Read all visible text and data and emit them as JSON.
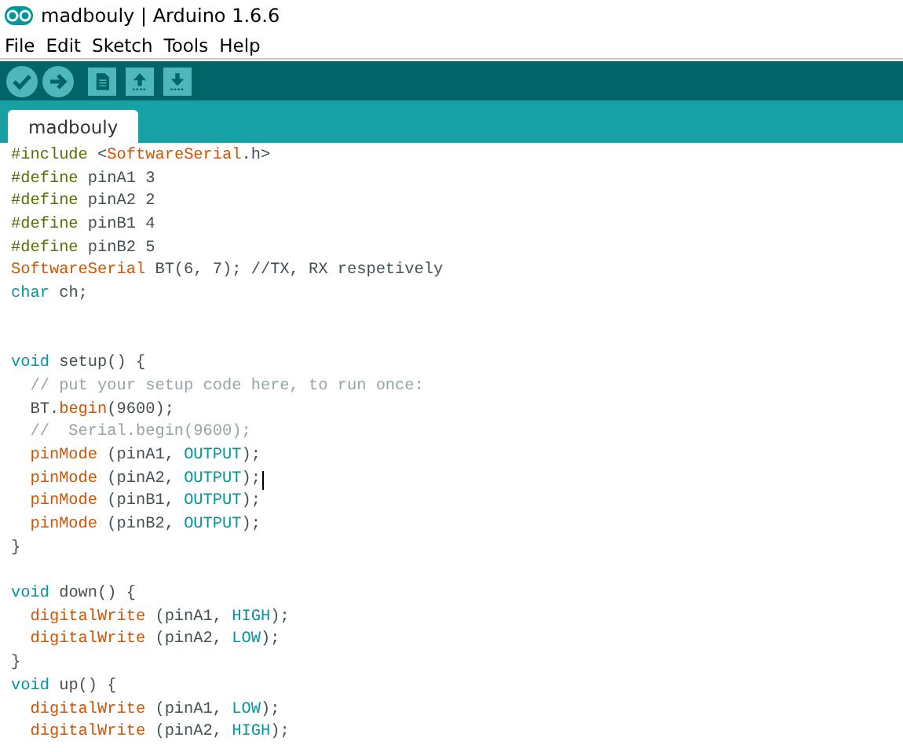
{
  "window": {
    "title": "madbouly | Arduino 1.6.6"
  },
  "menu": [
    "File",
    "Edit",
    "Sketch",
    "Tools",
    "Help"
  ],
  "toolbar": [
    {
      "kind": "verify"
    },
    {
      "kind": "upload"
    },
    {
      "kind": "new"
    },
    {
      "kind": "open"
    },
    {
      "kind": "save"
    }
  ],
  "tabs": [
    {
      "label": "madbouly",
      "selected": true
    }
  ],
  "editor": {
    "lines": [
      {
        "kind": "code",
        "caret": false,
        "tokens": [
          {
            "kind": "directive",
            "text": "#include "
          },
          {
            "kind": "plain",
            "text": "<"
          },
          {
            "kind": "function",
            "text": "SoftwareSerial"
          },
          {
            "kind": "plain",
            "text": ".h>"
          }
        ]
      },
      {
        "kind": "code",
        "caret": false,
        "tokens": [
          {
            "kind": "directive",
            "text": "#define "
          },
          {
            "kind": "plain",
            "text": "pinA1 3"
          }
        ]
      },
      {
        "kind": "code",
        "caret": false,
        "tokens": [
          {
            "kind": "directive",
            "text": "#define "
          },
          {
            "kind": "plain",
            "text": "pinA2 2"
          }
        ]
      },
      {
        "kind": "code",
        "caret": false,
        "tokens": [
          {
            "kind": "directive",
            "text": "#define "
          },
          {
            "kind": "plain",
            "text": "pinB1 4"
          }
        ]
      },
      {
        "kind": "code",
        "caret": false,
        "tokens": [
          {
            "kind": "directive",
            "text": "#define "
          },
          {
            "kind": "plain",
            "text": "pinB2 5"
          }
        ]
      },
      {
        "kind": "code",
        "caret": false,
        "tokens": [
          {
            "kind": "function",
            "text": "SoftwareSerial"
          },
          {
            "kind": "plain",
            "text": " BT(6, 7); //TX, RX respetively"
          }
        ]
      },
      {
        "kind": "code",
        "caret": false,
        "tokens": [
          {
            "kind": "keyword",
            "text": "char"
          },
          {
            "kind": "plain",
            "text": " ch;"
          }
        ]
      },
      {
        "kind": "blank"
      },
      {
        "kind": "blank"
      },
      {
        "kind": "code",
        "caret": false,
        "tokens": [
          {
            "kind": "keyword",
            "text": "void"
          },
          {
            "kind": "plain",
            "text": " setup() {"
          }
        ]
      },
      {
        "kind": "code",
        "caret": false,
        "tokens": [
          {
            "kind": "comment",
            "text": "  // put your setup code here, to run once:"
          }
        ]
      },
      {
        "kind": "code",
        "caret": false,
        "tokens": [
          {
            "kind": "plain",
            "text": "  BT."
          },
          {
            "kind": "function",
            "text": "begin"
          },
          {
            "kind": "plain",
            "text": "(9600);"
          }
        ]
      },
      {
        "kind": "code",
        "caret": false,
        "tokens": [
          {
            "kind": "comment",
            "text": "  //  Serial.begin(9600);"
          }
        ]
      },
      {
        "kind": "code",
        "caret": false,
        "tokens": [
          {
            "kind": "function",
            "text": "  pinMode"
          },
          {
            "kind": "plain",
            "text": " (pinA1, "
          },
          {
            "kind": "constant",
            "text": "OUTPUT"
          },
          {
            "kind": "plain",
            "text": ");"
          }
        ]
      },
      {
        "kind": "code",
        "caret": true,
        "tokens": [
          {
            "kind": "function",
            "text": "  pinMode"
          },
          {
            "kind": "plain",
            "text": " (pinA2, "
          },
          {
            "kind": "constant",
            "text": "OUTPUT"
          },
          {
            "kind": "plain",
            "text": ");"
          }
        ]
      },
      {
        "kind": "code",
        "caret": false,
        "tokens": [
          {
            "kind": "function",
            "text": "  pinMode"
          },
          {
            "kind": "plain",
            "text": " (pinB1, "
          },
          {
            "kind": "constant",
            "text": "OUTPUT"
          },
          {
            "kind": "plain",
            "text": ");"
          }
        ]
      },
      {
        "kind": "code",
        "caret": false,
        "tokens": [
          {
            "kind": "function",
            "text": "  pinMode"
          },
          {
            "kind": "plain",
            "text": " (pinB2, "
          },
          {
            "kind": "constant",
            "text": "OUTPUT"
          },
          {
            "kind": "plain",
            "text": ");"
          }
        ]
      },
      {
        "kind": "code",
        "caret": false,
        "tokens": [
          {
            "kind": "plain",
            "text": "}"
          }
        ]
      },
      {
        "kind": "blank"
      },
      {
        "kind": "code",
        "caret": false,
        "tokens": [
          {
            "kind": "keyword",
            "text": "void"
          },
          {
            "kind": "plain",
            "text": " down() {"
          }
        ]
      },
      {
        "kind": "code",
        "caret": false,
        "tokens": [
          {
            "kind": "function",
            "text": "  digitalWrite"
          },
          {
            "kind": "plain",
            "text": " (pinA1, "
          },
          {
            "kind": "constant",
            "text": "HIGH"
          },
          {
            "kind": "plain",
            "text": ");"
          }
        ]
      },
      {
        "kind": "code",
        "caret": false,
        "tokens": [
          {
            "kind": "function",
            "text": "  digitalWrite"
          },
          {
            "kind": "plain",
            "text": " (pinA2, "
          },
          {
            "kind": "constant",
            "text": "LOW"
          },
          {
            "kind": "plain",
            "text": ");"
          }
        ]
      },
      {
        "kind": "code",
        "caret": false,
        "tokens": [
          {
            "kind": "plain",
            "text": "}"
          }
        ]
      },
      {
        "kind": "code",
        "caret": false,
        "tokens": [
          {
            "kind": "keyword",
            "text": "void"
          },
          {
            "kind": "plain",
            "text": " up() {"
          }
        ]
      },
      {
        "kind": "code",
        "caret": false,
        "tokens": [
          {
            "kind": "function",
            "text": "  digitalWrite"
          },
          {
            "kind": "plain",
            "text": " (pinA1, "
          },
          {
            "kind": "constant",
            "text": "LOW"
          },
          {
            "kind": "plain",
            "text": ");"
          }
        ]
      },
      {
        "kind": "code",
        "caret": false,
        "tokens": [
          {
            "kind": "function",
            "text": "  digitalWrite"
          },
          {
            "kind": "plain",
            "text": " (pinA2, "
          },
          {
            "kind": "constant",
            "text": "HIGH"
          },
          {
            "kind": "plain",
            "text": ");"
          }
        ]
      }
    ]
  }
}
